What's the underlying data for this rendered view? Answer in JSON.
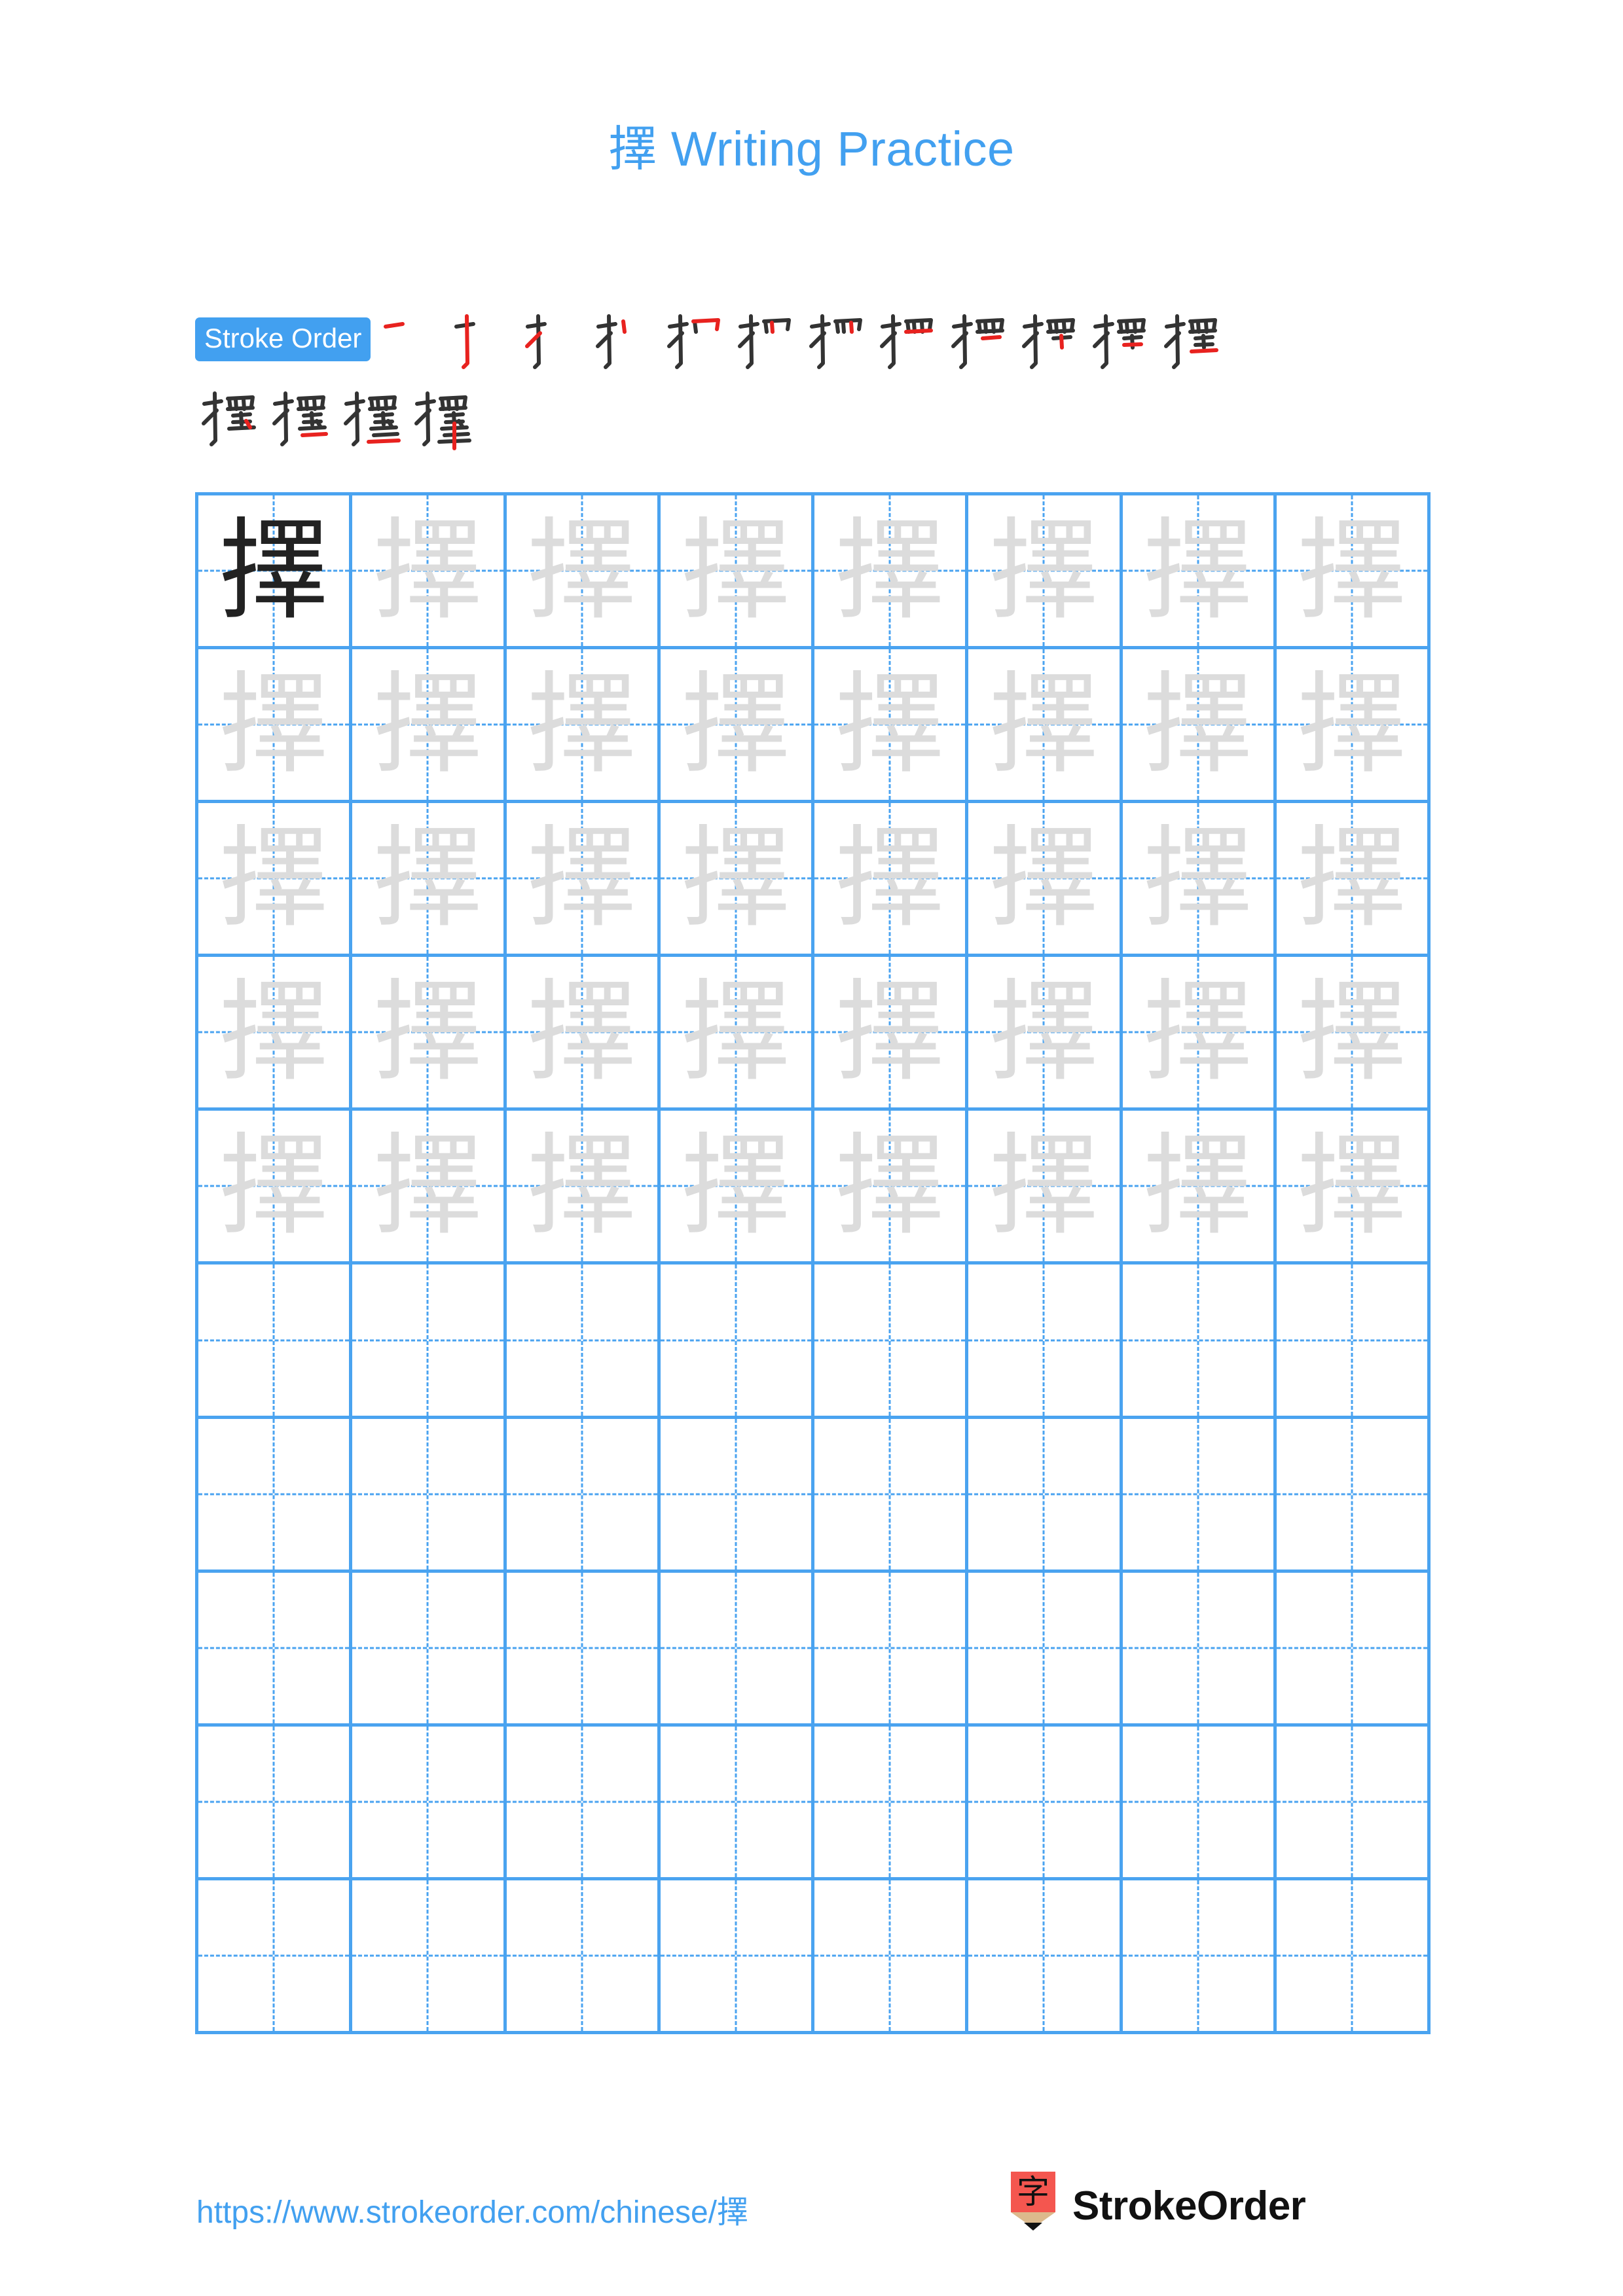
{
  "document": {
    "character": "擇",
    "title_suffix": " Writing Practice",
    "title_full": "擇 Writing Practice",
    "page_background": "#ffffff",
    "accent_blue": "#42a0f0",
    "grid_line_color": "#4aa3f0",
    "model_glyph_color": "#222222",
    "trace_glyph_color": "#dcdcdc",
    "stroke_new_color": "#e8221f",
    "stroke_done_color": "#333333"
  },
  "stroke_order": {
    "badge_label": "Stroke Order",
    "total_strokes": 16,
    "rows": [
      {
        "steps": [
          1,
          2,
          3,
          4,
          5,
          6,
          7,
          8,
          9,
          10,
          11,
          12
        ]
      },
      {
        "steps": [
          13,
          14,
          15,
          16
        ]
      }
    ]
  },
  "practice_grid": {
    "columns": 8,
    "rows": 10,
    "filled_rows": 5,
    "empty_rows": 5,
    "cells": [
      [
        "model",
        "trace",
        "trace",
        "trace",
        "trace",
        "trace",
        "trace",
        "trace"
      ],
      [
        "trace",
        "trace",
        "trace",
        "trace",
        "trace",
        "trace",
        "trace",
        "trace"
      ],
      [
        "trace",
        "trace",
        "trace",
        "trace",
        "trace",
        "trace",
        "trace",
        "trace"
      ],
      [
        "trace",
        "trace",
        "trace",
        "trace",
        "trace",
        "trace",
        "trace",
        "trace"
      ],
      [
        "trace",
        "trace",
        "trace",
        "trace",
        "trace",
        "trace",
        "trace",
        "trace"
      ],
      [
        "blank",
        "blank",
        "blank",
        "blank",
        "blank",
        "blank",
        "blank",
        "blank"
      ],
      [
        "blank",
        "blank",
        "blank",
        "blank",
        "blank",
        "blank",
        "blank",
        "blank"
      ],
      [
        "blank",
        "blank",
        "blank",
        "blank",
        "blank",
        "blank",
        "blank",
        "blank"
      ],
      [
        "blank",
        "blank",
        "blank",
        "blank",
        "blank",
        "blank",
        "blank",
        "blank"
      ],
      [
        "blank",
        "blank",
        "blank",
        "blank",
        "blank",
        "blank",
        "blank",
        "blank"
      ]
    ]
  },
  "footer": {
    "url": "https://www.strokeorder.com/chinese/擇",
    "brand_name": "StrokeOrder",
    "logo_character": "字",
    "logo_body_color": "#f4564f",
    "logo_wood_color": "#dcb98c",
    "logo_tip_color": "#111111"
  }
}
